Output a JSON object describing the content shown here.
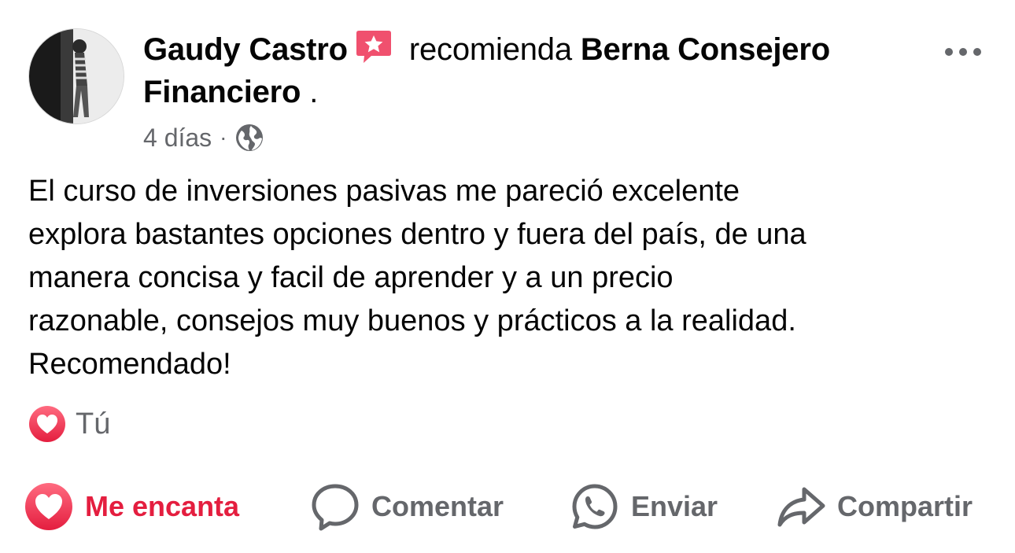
{
  "post": {
    "author": "Gaudy Castro",
    "action_word": "recomienda",
    "page_name": "Berna Consejero Financiero",
    "page_suffix": " .",
    "time": "4 días",
    "separator": "·",
    "privacy_icon": "globe-icon",
    "body": "El curso de inversiones pasivas me pareció excelente\nexplora bastantes opciones dentro y fuera del país, de una\nmanera concisa y facil de aprender y a un precio\nrazonable, consejos muy buenos y prácticos a la realidad.\nRecomendado!",
    "reaction_icon": "heart-reaction-icon",
    "reaction_by": "Tú"
  },
  "actions": {
    "love_label": "Me encanta",
    "comment_label": "Comentar",
    "send_label": "Enviar",
    "share_label": "Compartir"
  },
  "colors": {
    "love": "#e41e3f",
    "muted": "#65676b",
    "recommend_badge": "#f0506e"
  }
}
